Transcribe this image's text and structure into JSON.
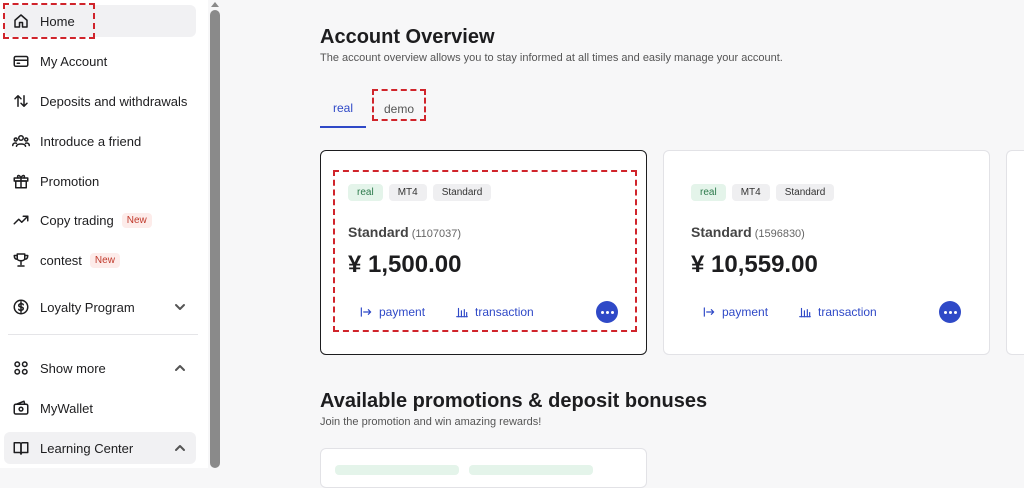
{
  "sidebar": {
    "items": [
      {
        "label": "Home",
        "icon": "home-icon"
      },
      {
        "label": "My Account",
        "icon": "account-card-icon"
      },
      {
        "label": "Deposits and withdrawals",
        "icon": "transfer-arrows-icon"
      },
      {
        "label": "Introduce a friend",
        "icon": "people-icon"
      },
      {
        "label": "Promotion",
        "icon": "gift-icon"
      },
      {
        "label": "Copy trading",
        "icon": "trend-up-icon",
        "badge": "New"
      },
      {
        "label": "contest",
        "icon": "trophy-icon",
        "badge": "New"
      },
      {
        "label": "Loyalty Program",
        "icon": "dollar-coin-icon"
      },
      {
        "label": "Show more",
        "icon": "grid-icon"
      },
      {
        "label": "MyWallet",
        "icon": "wallet-icon"
      },
      {
        "label": "Learning Center",
        "icon": "book-icon"
      }
    ]
  },
  "overview": {
    "title": "Account Overview",
    "subtitle": "The account overview allows you to stay informed at all times and easily manage your account.",
    "tabs": [
      "real",
      "demo"
    ]
  },
  "accounts": [
    {
      "tags": [
        "real",
        "MT4",
        "Standard"
      ],
      "name": "Standard",
      "number": "(1107037)",
      "balance": "¥ 1,500.00",
      "payment": "payment",
      "transaction": "transaction"
    },
    {
      "tags": [
        "real",
        "MT4",
        "Standard"
      ],
      "name": "Standard",
      "number": "(1596830)",
      "balance": "¥ 10,559.00",
      "payment": "payment",
      "transaction": "transaction"
    }
  ],
  "promotions": {
    "title": "Available promotions & deposit bonuses",
    "subtitle": "Join the promotion and win amazing rewards!"
  },
  "colors": {
    "accent": "#2f49c7",
    "highlight": "#d0242b",
    "tag_green": "#e4f4ea"
  }
}
